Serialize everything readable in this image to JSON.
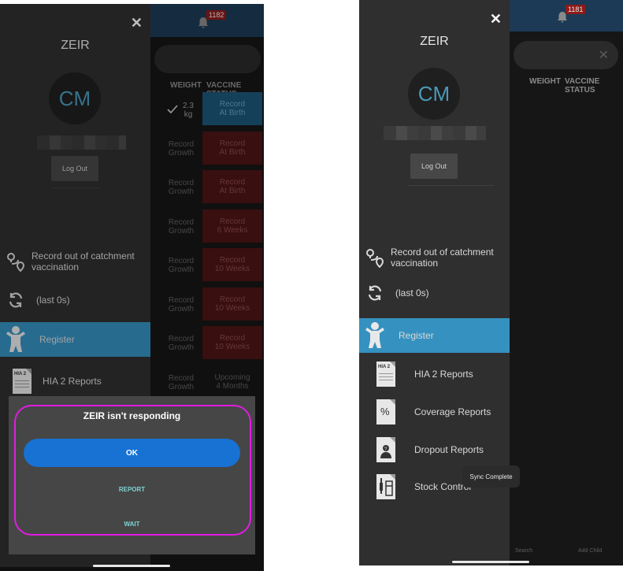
{
  "left": {
    "app_name": "ZEIR",
    "avatar_initials": "CM",
    "logout_label": "Log Out",
    "notification_count": "1182",
    "columns": {
      "weight": "WEIGHT",
      "vaccine_status": "VACCINE STATUS"
    },
    "rows": [
      {
        "weight": "2.3\nkg",
        "vaccine": "Record\nAt Birth"
      },
      {
        "weight": "Record\nGrowth",
        "vaccine": "Record\nAt Birth"
      },
      {
        "weight": "Record\nGrowth",
        "vaccine": "Record\nAt Birth"
      },
      {
        "weight": "Record\nGrowth",
        "vaccine": "Record\n6 Weeks"
      },
      {
        "weight": "Record\nGrowth",
        "vaccine": "Record\n10 Weeks"
      },
      {
        "weight": "Record\nGrowth",
        "vaccine": "Record\n10 Weeks"
      },
      {
        "weight": "Record\nGrowth",
        "vaccine": "Record\n10 Weeks"
      },
      {
        "weight": "Record\nGrowth",
        "vaccine": "Upcoming\n4 Months"
      }
    ],
    "menu": {
      "out_of_catchment": "Record out of catchment vaccination",
      "sync": "(last 0s)",
      "register": "Register",
      "hia2": "HIA 2 Reports"
    },
    "dialog": {
      "title": "ZEIR isn't responding",
      "ok": "OK",
      "report": "REPORT",
      "wait": "WAIT"
    }
  },
  "right": {
    "app_name": "ZEIR",
    "avatar_initials": "CM",
    "logout_label": "Log Out",
    "notification_count": "1181",
    "columns": {
      "weight": "WEIGHT",
      "vaccine_status": "VACCINE STATUS"
    },
    "menu": {
      "out_of_catchment": "Record out of catchment vaccination",
      "sync": "(last 0s)",
      "register": "Register",
      "hia2": "HIA 2 Reports",
      "coverage": "Coverage Reports",
      "dropout": "Dropout Reports",
      "stock": "Stock Control"
    },
    "doc_icon_label": "HIA 2",
    "toast": "Sync Complete",
    "bottom_nav": {
      "search": "Search",
      "add_child": "Add Child"
    }
  },
  "colors": {
    "accent": "#3591bf",
    "ok_button": "#1772d4",
    "highlight": "#e11be1"
  }
}
